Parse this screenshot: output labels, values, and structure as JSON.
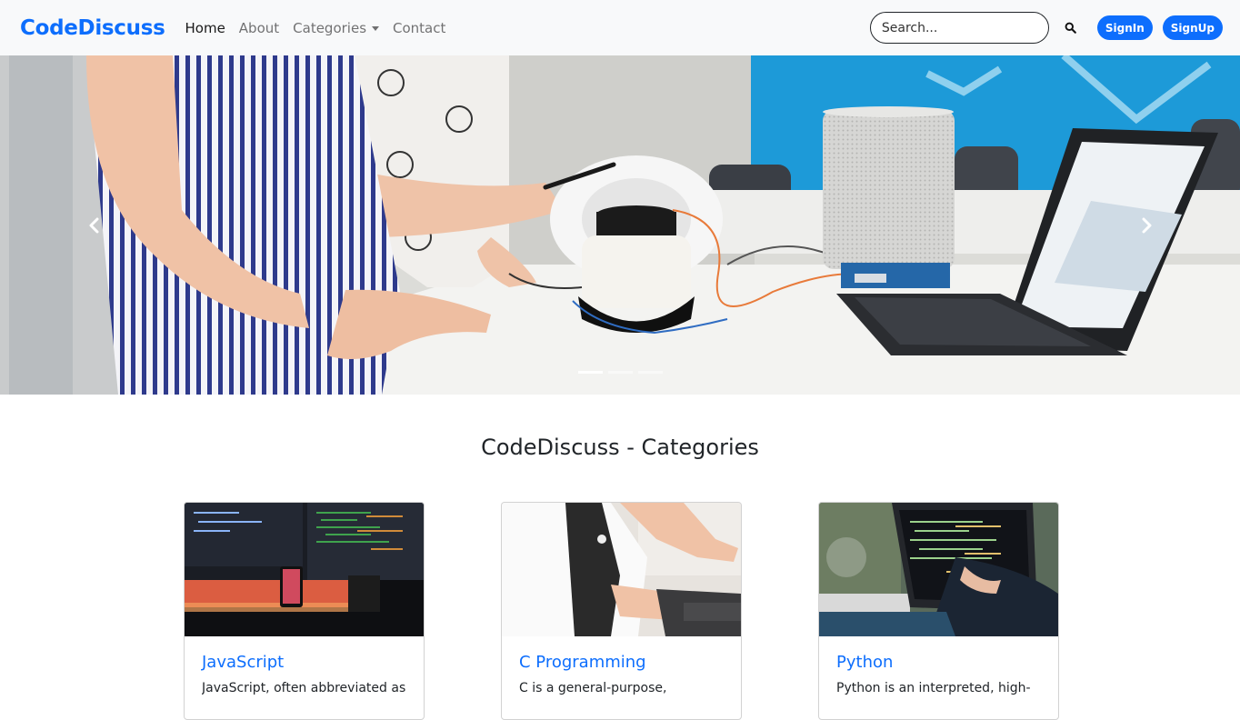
{
  "navbar": {
    "brand": "CodeDiscuss",
    "links": [
      "Home",
      "About",
      "Categories",
      "Contact"
    ],
    "search_placeholder": "Search...",
    "signin_label": "SignIn",
    "signup_label": "SignUp",
    "colors": {
      "accent": "#0d6efd",
      "background": "#f8f9fa"
    }
  },
  "carousel": {
    "slide_count": 3,
    "active_slide": 1,
    "prev_icon": "chevron-left-icon",
    "next_icon": "chevron-right-icon"
  },
  "categories": {
    "title": "CodeDiscuss - Categories",
    "cards": [
      {
        "title": "JavaScript",
        "text": "JavaScript, often abbreviated as"
      },
      {
        "title": "C Programming",
        "text": "C is a general-purpose,"
      },
      {
        "title": "Python",
        "text": "Python is an interpreted, high-"
      }
    ]
  }
}
